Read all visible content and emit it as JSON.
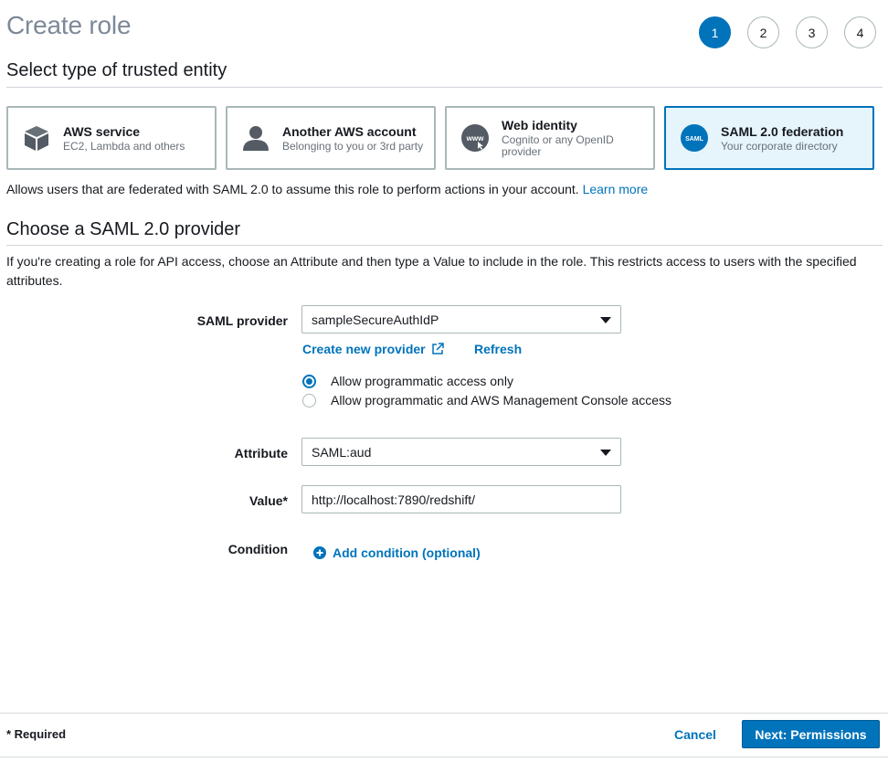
{
  "page": {
    "title": "Create role"
  },
  "steps": [
    "1",
    "2",
    "3",
    "4"
  ],
  "trusted_entity": {
    "heading": "Select type of trusted entity",
    "cards": [
      {
        "title": "AWS service",
        "subtitle": "EC2, Lambda and others",
        "icon": "cube-icon"
      },
      {
        "title": "Another AWS account",
        "subtitle": "Belonging to you or 3rd party",
        "icon": "person-icon"
      },
      {
        "title": "Web identity",
        "subtitle": "Cognito or any OpenID provider",
        "icon": "www-icon"
      },
      {
        "title": "SAML 2.0 federation",
        "subtitle": "Your corporate directory",
        "icon": "saml-icon",
        "icon_text": "SAML"
      }
    ],
    "description": "Allows users that are federated with SAML 2.0 to assume this role to perform actions in your account.",
    "learn_more": "Learn more"
  },
  "saml": {
    "heading": "Choose a SAML 2.0 provider",
    "info": "If you're creating a role for API access, choose an Attribute and then type a Value to include in the role. This restricts access to users with the specified attributes.",
    "provider_label": "SAML provider",
    "provider_value": "sampleSecureAuthIdP",
    "create_provider": "Create new provider",
    "refresh": "Refresh",
    "radio_options": [
      "Allow programmatic access only",
      "Allow programmatic and AWS Management Console access"
    ],
    "attribute_label": "Attribute",
    "attribute_value": "SAML:aud",
    "value_label": "Value*",
    "value_value": "http://localhost:7890/redshift/",
    "condition_label": "Condition",
    "add_condition": "Add condition (optional)"
  },
  "footer": {
    "required": "* Required",
    "cancel": "Cancel",
    "next": "Next: Permissions"
  },
  "colors": {
    "accent": "#0073bb",
    "selected_bg": "#e6f4fb",
    "icon_gray": "#545b64"
  }
}
